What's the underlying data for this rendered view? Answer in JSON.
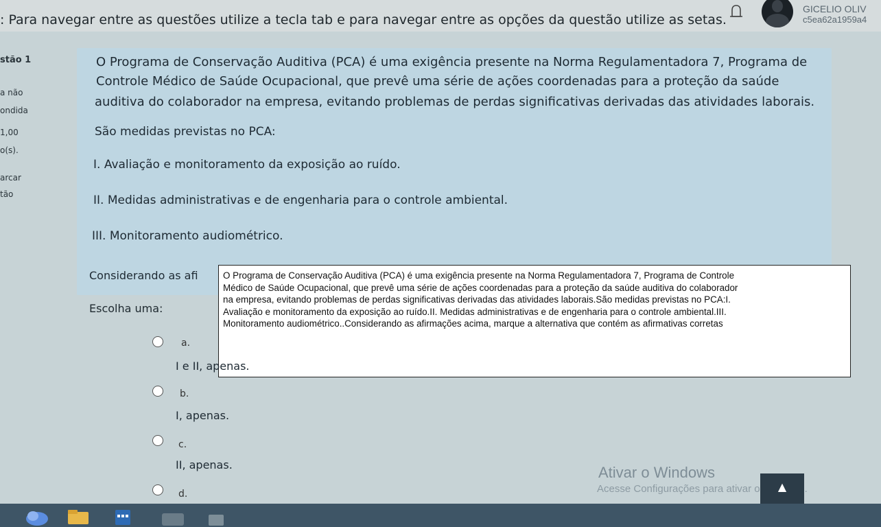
{
  "user": {
    "name": "GICELIO OLIV",
    "code": "c5ea62a1959a4"
  },
  "instruction": ": Para navegar entre as questões utilize a tecla tab e para navegar entre as opções da questão utilize as setas.",
  "sidebar": {
    "items": [
      "stão 1",
      "a não",
      "ondida",
      "1,00",
      "o(s).",
      "arcar",
      "tão"
    ]
  },
  "question": {
    "intro": [
      "O Programa de Conservação Auditiva (PCA) é uma exigência presente na Norma Regulamentadora 7, Programa de",
      "Controle Médico de Saúde Ocupacional, que prevê uma série de ações coordenadas para a proteção da saúde",
      "auditiva do colaborador na empresa, evitando problemas de perdas significativas derivadas das atividades laborais.",
      "São medidas previstas no PCA:"
    ],
    "statements": [
      "I. Avaliação e monitoramento da exposição ao ruído.",
      "II. Medidas administrativas e de engenharia para o controle ambiental.",
      "III. Monitoramento audiométrico."
    ],
    "considering": "Considerando as afi",
    "choose": "Escolha uma:",
    "tooltip_lines": [
      "O Programa de Conservação Auditiva (PCA) é uma exigência presente na Norma Regulamentadora 7, Programa de Controle",
      "Médico de Saúde Ocupacional, que prevê uma série de ações coordenadas para a proteção da saúde auditiva do colaborador",
      "na empresa, evitando problemas de perdas significativas derivadas das atividades laborais.São medidas previstas no PCA:I.",
      "Avaliação e monitoramento da exposição ao ruído.II. Medidas administrativas e de engenharia para o controle ambiental.III.",
      "Monitoramento audiométrico..Considerando as afirmações acima, marque a alternativa que contém as afirmativas corretas"
    ],
    "options": [
      {
        "letter": "a.",
        "text": "I e II, apenas."
      },
      {
        "letter": "b.",
        "text": "I, apenas."
      },
      {
        "letter": "c.",
        "text": "II, apenas."
      },
      {
        "letter": "d.",
        "text": ""
      }
    ]
  },
  "watermark": {
    "title": "Ativar o Windows",
    "subtitle": "Acesse Configurações para ativar o Windows."
  },
  "colors": {
    "question_bg": "#bed6e2",
    "page_bg": "#c7d3d6",
    "taskbar": "#3e5566"
  }
}
